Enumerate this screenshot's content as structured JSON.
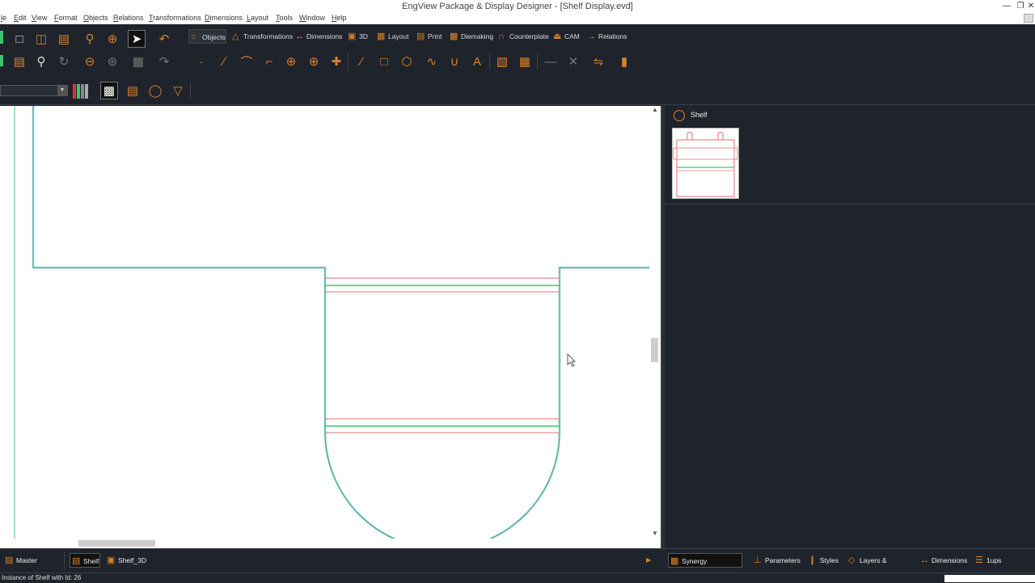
{
  "window": {
    "title": "EngView Package & Display Designer - [Shelf Display.evd]"
  },
  "menu": [
    "le",
    "Edit",
    "View",
    "Format",
    "Objects",
    "Relations",
    "Transformations",
    "Dimensions",
    "Layout",
    "Tools",
    "Window",
    "Help"
  ],
  "tabs": [
    "Objects",
    "Transformations",
    "Dimensions",
    "3D",
    "Layout",
    "Print",
    "Diemaking",
    "Counterplate",
    "CAM",
    "Relations"
  ],
  "right_panel": {
    "item_label": "Shelf"
  },
  "bottom_tabs": [
    "Master Canvas",
    "Shelf",
    "Shelf_3D"
  ],
  "panel_tabs": [
    "Synergy Components",
    "Parameters",
    "Styles",
    "Layers & Objects",
    "Dimensions",
    "1ups"
  ],
  "status": {
    "text": "Instance of Shelf  with Id:  26"
  },
  "colors": {
    "accent": "#d9822b",
    "cut_line": "#e07070",
    "crease_line": "#3ec46d",
    "background": "#1f232b"
  }
}
